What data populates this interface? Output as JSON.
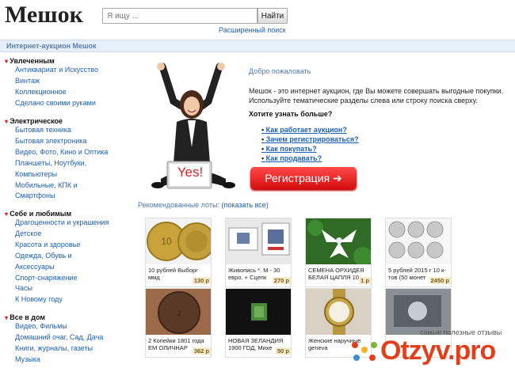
{
  "header": {
    "logo_text": "Мешок",
    "search_placeholder": "Я ищу ...",
    "search_button": "Найти",
    "advanced_search": "Расширенный поиск"
  },
  "titlebar": {
    "text": "Интернет-аукцион Мешок"
  },
  "sidebar": {
    "categories": [
      {
        "title": "Увлеченным",
        "items": [
          "Антиквариат и Искусство",
          "Винтаж",
          "Коллекционное",
          "Сделано своими руками"
        ]
      },
      {
        "title": "Электрическое",
        "items": [
          "Бытовая техника",
          "Бытовая электроника",
          "Видео, Фото, Кино и Оптика",
          "Планшеты, Ноутбуки,",
          "Компьютеры",
          "Мобильные, КПК и",
          "Смартфоны"
        ]
      },
      {
        "title": "Себе и любимым",
        "items": [
          "Драгоценности и украшения",
          "Детское",
          "Красота и здоровье",
          "Одежда, Обувь и",
          "Аксессуары",
          "Спорт-снаряжение",
          "Часы",
          "К Новому году"
        ]
      },
      {
        "title": "Все в дом",
        "items": [
          "Видео, Фильмы",
          "Домашний очаг, Сад, Дача",
          "Книги, журналы, газеты",
          "Музыка"
        ]
      }
    ]
  },
  "hero": {
    "sign_text": "Yes!"
  },
  "main": {
    "welcome": "Добро пожаловать",
    "intro": "Мешок - это интернет аукцион, где Вы можете совершать выгодные покупки. Используйте тематические разделы слева или строку поиска сверху.",
    "more_title": "Хотите узнать больше?",
    "links": [
      "Как работает аукцион?",
      "Зачем регистрироваться?",
      "Как покупать?",
      "Как продавать?"
    ],
    "register_button": "Регистрация  ➔"
  },
  "recommended": {
    "label": "Рекомендованные лоты:",
    "show_all": "(показать все)",
    "lots": [
      {
        "title": "10 рублей Выборг ммд",
        "price": "130 р"
      },
      {
        "title": "Живопись *. М - 30 евро. + Сцепк",
        "price": "270 р"
      },
      {
        "title": "СЕМЕНА ОРХИДЕЯ БЕЛАЯ ЦАПЛЯ 10",
        "price": "1 р"
      },
      {
        "title": "5 рублей 2015 г 10 к-тов (50 монет",
        "price": "2450 р"
      },
      {
        "title": "2 Копейки 1801 года ЕМ ОЛИЧНАР",
        "price": "362 р"
      },
      {
        "title": "НОВАЯ ЗЕЛАНДИЯ 1900 ГОД, Михе",
        "price": "50 р"
      },
      {
        "title": "Женские наручные geneva",
        "price": ""
      },
      {
        "title": "",
        "price": ""
      }
    ]
  },
  "watermark": {
    "caption": "самые полезные отзывы",
    "site": "Otzyv.pro"
  },
  "colors": {
    "accent_red": "#d22222",
    "link_blue": "#1a5fb4",
    "watermark_orange": "#e2401c"
  }
}
